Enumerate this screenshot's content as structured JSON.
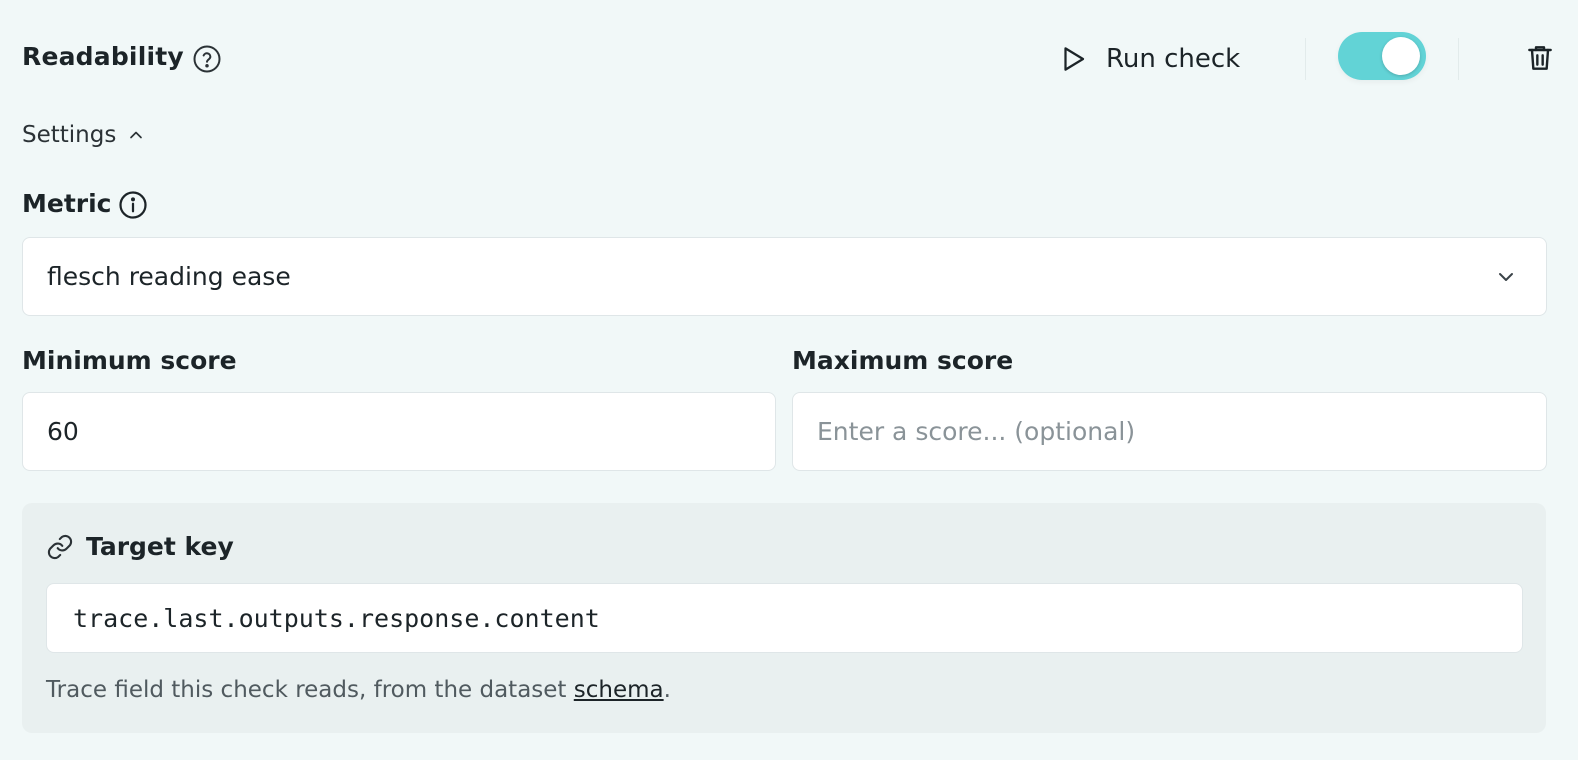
{
  "header": {
    "title": "Readability",
    "run_label": "Run check",
    "enabled": true
  },
  "settings": {
    "label": "Settings"
  },
  "metric": {
    "label": "Metric",
    "value": "flesch reading ease"
  },
  "min_score": {
    "label": "Minimum score",
    "value": "60"
  },
  "max_score": {
    "label": "Maximum score",
    "value": "",
    "placeholder": "Enter a score... (optional)"
  },
  "target": {
    "label": "Target key",
    "value": "trace.last.outputs.response.content",
    "hint_prefix": "Trace field this check reads, from the dataset ",
    "hint_link": "schema",
    "hint_suffix": "."
  },
  "colors": {
    "background": "#f1f8f8",
    "toggle_on": "#62d3d6",
    "panel": "#e9f0f0"
  },
  "icons": [
    "help-icon",
    "play-icon",
    "trash-icon",
    "chevron-up-icon",
    "info-icon",
    "chevron-down-icon",
    "link-icon"
  ]
}
